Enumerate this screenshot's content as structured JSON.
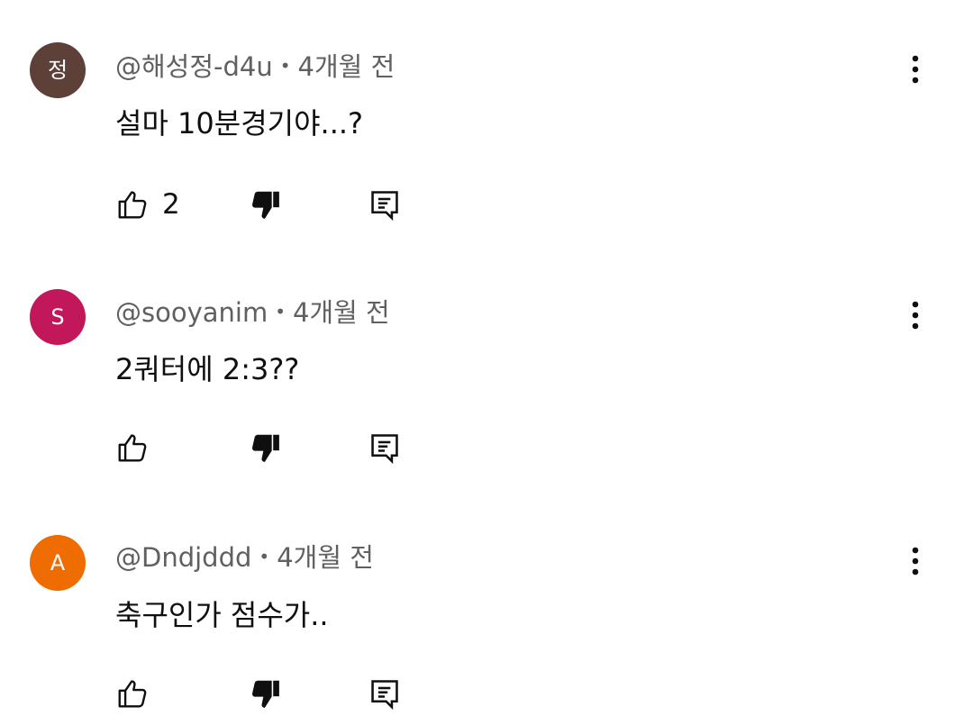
{
  "comments": [
    {
      "avatar_letter": "정",
      "avatar_color": "#5d4037",
      "author": "@해성정-d4u",
      "separator": "•",
      "time": "4개월 전",
      "text": "설마 10분경기야...?",
      "like_count": "2"
    },
    {
      "avatar_letter": "S",
      "avatar_color": "#c2185b",
      "author": "@sooyanim",
      "separator": "•",
      "time": "4개월 전",
      "text": "2쿼터에 2:3??",
      "like_count": ""
    },
    {
      "avatar_letter": "A",
      "avatar_color": "#ef6c00",
      "author": "@Dndjddd",
      "separator": "•",
      "time": "4개월 전",
      "text": "축구인가 점수가..",
      "like_count": ""
    }
  ],
  "icons": {
    "like": "thumb-up-outline-icon",
    "dislike": "thumb-down-filled-icon",
    "reply": "comment-reply-icon",
    "menu": "more-vert-icon"
  }
}
